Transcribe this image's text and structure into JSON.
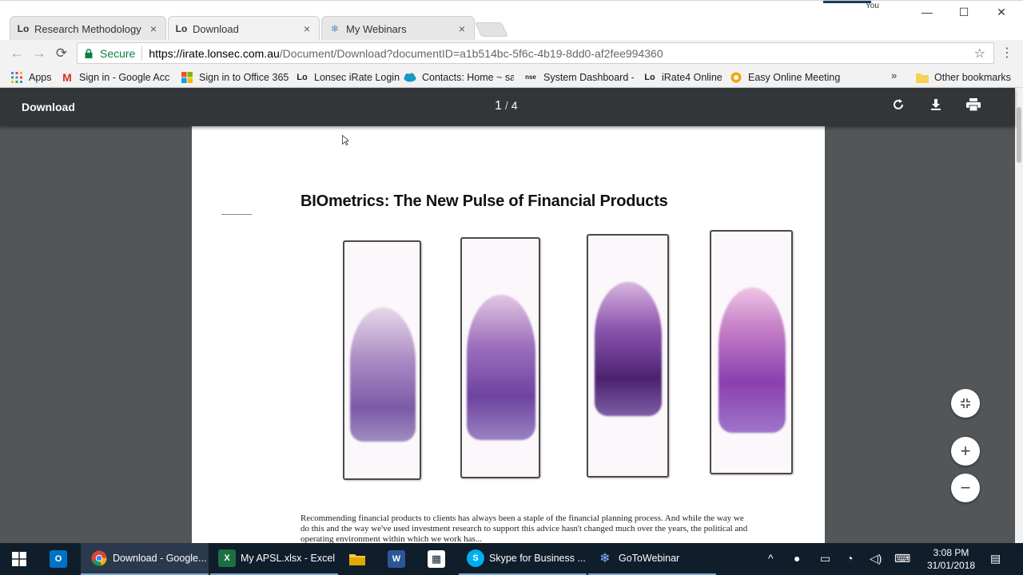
{
  "window": {
    "profile": "You",
    "controls": [
      "—",
      "☐",
      "✕"
    ]
  },
  "tabs": [
    {
      "label": "Research Methodology",
      "icon": "lonsec-lo-icon",
      "glyph": "Lo"
    },
    {
      "label": "Download",
      "icon": "lonsec-lo-icon",
      "glyph": "Lo",
      "active": true
    },
    {
      "label": "My Webinars",
      "icon": "gotowebinar-icon",
      "glyph": "❄"
    }
  ],
  "toolbar": {
    "secure_label": "Secure",
    "url_host": "https://irate.lonsec.com.au",
    "url_path": "/Document/Download?documentID=a1b514bc-5f6c-4b19-8dd0-af2fee994360"
  },
  "bookmarks": [
    {
      "label": "Apps",
      "icon": "apps-grid-icon"
    },
    {
      "label": "Sign in - Google Acc",
      "icon": "gmail-icon"
    },
    {
      "label": "Sign in to Office 365",
      "icon": "microsoft-icon"
    },
    {
      "label": "Lonsec iRate Login",
      "icon": "lonsec-lo-icon"
    },
    {
      "label": "Contacts: Home ~ sal",
      "icon": "salesforce-cloud-icon"
    },
    {
      "label": "System Dashboard - J",
      "icon": "nse-icon"
    },
    {
      "label": "iRate4 Online",
      "icon": "lonsec-lo-icon"
    },
    {
      "label": "Easy Online Meeting",
      "icon": "meeting-icon"
    }
  ],
  "other_bookmarks": "Other bookmarks",
  "pdf": {
    "title": "Download",
    "current_page": "1",
    "total_pages": "4",
    "heading": "BIOmetrics: The New Pulse of Financial Products",
    "body_line1": "Recommending financial products to clients has always been a staple of the financial planning process. And while the way we",
    "body_line2": "do this and the way we've used investment research to support this advice hasn't changed much over the years, the political and",
    "body_line3": "operating environment within which we work has..."
  },
  "taskbar": {
    "items": [
      {
        "label": "Download - Google...",
        "icon": "chrome-icon"
      },
      {
        "label": "My APSL.xlsx - Excel",
        "icon": "excel-icon"
      },
      {
        "label": "Skype for Business ...",
        "icon": "skype-icon"
      },
      {
        "label": "GoToWebinar",
        "icon": "gotowebinar-icon"
      }
    ],
    "time": "3:08 PM",
    "date": "31/01/2018"
  },
  "colors": {
    "pdf_toolbar": "#323639",
    "pdf_background": "#525659",
    "secure_green": "#0b8043",
    "taskbar": "#101d2b"
  }
}
